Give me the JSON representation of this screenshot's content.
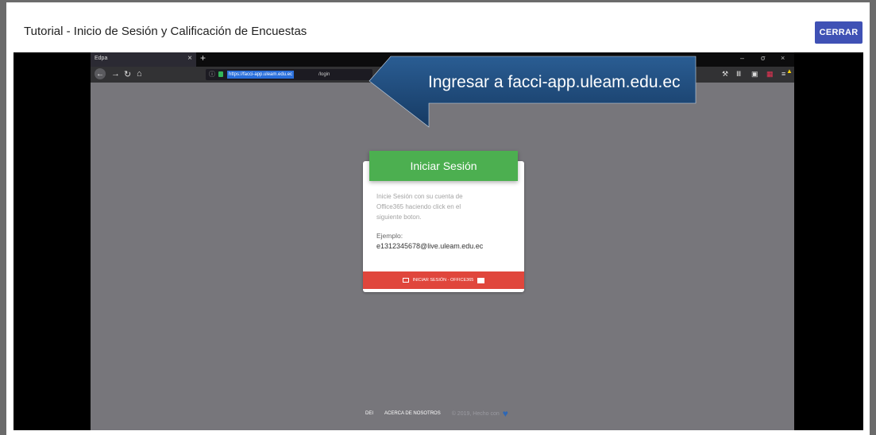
{
  "dialog": {
    "title": "Tutorial - Inicio de Sesión y Calificación de Encuestas",
    "close_label": "CERRAR"
  },
  "browser": {
    "tab_title": "Edpa",
    "tab_close": "×",
    "new_tab": "+",
    "url_selected": "https://facci-app.uleam.edu.ec",
    "url_rest": "/login",
    "window_controls": [
      "–",
      "σ",
      "×"
    ]
  },
  "callout": {
    "text": "Ingresar a facci-app.uleam.edu.ec"
  },
  "login_card": {
    "title": "Iniciar Sesión",
    "description": "Inicie Sesión con su cuenta de Office365 haciendo click en el siguiente boton.",
    "example_label": "Ejemplo:",
    "example_value": "e1312345678@live.uleam.edu.ec",
    "button_label": "INICIAR SESIÓN - OFFICE365"
  },
  "footer": {
    "link1": "DEI",
    "link2": "ACERCA DE NOSOTROS",
    "copyright": "© 2019, Hecho con"
  },
  "colors": {
    "accent": "#3f51b5",
    "card_header": "#4caf50",
    "login_button": "#e0463c",
    "callout": "#1f4a7a",
    "page_bg": "#77767b"
  }
}
